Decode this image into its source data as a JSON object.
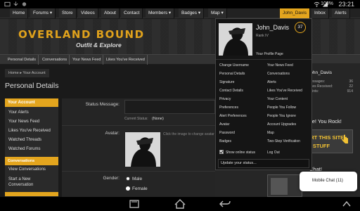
{
  "statusbar": {
    "time": "23:21",
    "battery": "100%"
  },
  "topnav": {
    "items": [
      "Home",
      "Forums ▾",
      "Store",
      "Videos",
      "About",
      "Contact",
      "Members ▾",
      "Badges ▾",
      "Map ▾"
    ],
    "user": "John_Davis",
    "inbox": "Inbox",
    "alerts": "Alerts"
  },
  "header": {
    "title": "OVERLAND BOUND",
    "subtitle": "Outfit & Explore"
  },
  "subnav": {
    "items": [
      "Personal Details",
      "Conversations",
      "Your News Feed",
      "Likes You've Received"
    ]
  },
  "breadcrumb": {
    "home": "Home",
    "current": "Your Account"
  },
  "page": {
    "title": "Personal Details"
  },
  "sidebar": {
    "account_head": "Your Account",
    "account_items": [
      "Your Alerts",
      "Your News Feed",
      "Likes You've Received",
      "Watched Threads",
      "Watched Forums"
    ],
    "conv_head": "Conversations",
    "conv_items": [
      "View Conversations",
      "Start a New Conversation"
    ]
  },
  "form": {
    "status_label": "Status Message:",
    "current_status_label": "Current Status:",
    "current_status_value": "(None)",
    "avatar_label": "Avatar:",
    "avatar_hint": "Click the image to change avatar",
    "gender_label": "Gender:",
    "gender_male": "Male",
    "gender_female": "Female"
  },
  "popup": {
    "username": "John_Davis",
    "rank": "Rank IV",
    "level": "37",
    "profile_link": "Your Profile Page",
    "left_links": [
      "Change Username",
      "Personal Details",
      "Signature",
      "Contact Details",
      "Privacy",
      "Preferences",
      "Alert Preferences",
      "Avatar",
      "Password",
      "Badges"
    ],
    "right_links": [
      "Your News Feed",
      "Conversations",
      "Alerts",
      "Likes You've Received",
      "Your Content",
      "People You Follow",
      "People You Ignore",
      "Account Upgrades",
      "Map",
      "Two-Step Verification"
    ],
    "show_online": "Show online status",
    "logout": "Log Out",
    "status_placeholder": "Update your status..."
  },
  "rightcol": {
    "username": "John_Davis",
    "stats": [
      {
        "label": "Messages:",
        "value": "36"
      },
      {
        "label": "Likes Received:",
        "value": "22"
      },
      {
        "label": "Points:",
        "value": "914"
      }
    ],
    "promo": "se! You Rock!",
    "ad_line1": "SUPPORT THIS SITE",
    "ad_line2": "...COOL STUFF",
    "chat_heading": "Chat!"
  },
  "chat": {
    "label": "Mobile Chat (11)"
  },
  "colors": {
    "accent": "#e3a51e",
    "background": "#1a1a1a"
  }
}
